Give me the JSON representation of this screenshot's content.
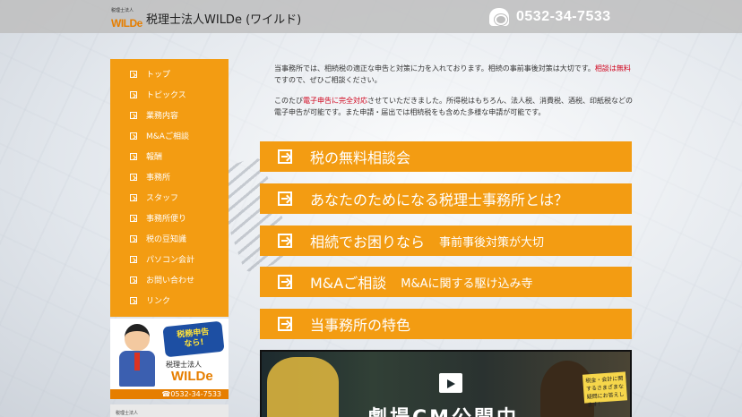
{
  "header": {
    "logo_small": "税理士法人",
    "logo_main": "WILDe",
    "title": "税理士法人WILDe (ワイルド)",
    "phone": "0532-34-7533"
  },
  "sidebar": {
    "items": [
      {
        "label": "トップ"
      },
      {
        "label": "トピックス"
      },
      {
        "label": "業務内容"
      },
      {
        "label": "M&Aご相談"
      },
      {
        "label": "報酬"
      },
      {
        "label": "事務所"
      },
      {
        "label": "スタッフ"
      },
      {
        "label": "事務所便り"
      },
      {
        "label": "税の豆知識"
      },
      {
        "label": "パソコン会計"
      },
      {
        "label": "お問い合わせ"
      },
      {
        "label": "リンク"
      }
    ],
    "banner": {
      "speech_line1": "税務申告",
      "speech_line2": "なら!",
      "firm": "税理士法人",
      "logo": "WILDe",
      "phone": "☎0532-34-7533"
    },
    "second_banner_text": "税理士法人"
  },
  "intro": {
    "p1_text": "当事務所では、相続税の適正な申告と対策に力を入れております。相続の事前事後対策は大切です。",
    "p1_red": "相談は無料",
    "p1_tail": "ですので、ぜひご相談ください。",
    "p2_head": "このたび",
    "p2_red": "電子申告に完全対応",
    "p2_tail": "させていただきました。所得税はもちろん、法人税、消費税、酒税、印紙税などの電子申告が可能です。また申請・届出では相続税をも含めた多様な申請が可能です。"
  },
  "cta": [
    {
      "title": "税の無料相談会",
      "sub": ""
    },
    {
      "title": "あなたのためになる税理士事務所とは？",
      "sub": ""
    },
    {
      "title": "相続でお困りなら",
      "sub": "事前事後対策が大切"
    },
    {
      "title": "M&Aご相談",
      "sub": "M&Aに関する駆け込み寺"
    },
    {
      "title": "当事務所の特色",
      "sub": ""
    }
  ],
  "video": {
    "title": "劇場CM公開中",
    "badge": "税金・会計に関するさまざまな疑問にお答えします！"
  }
}
